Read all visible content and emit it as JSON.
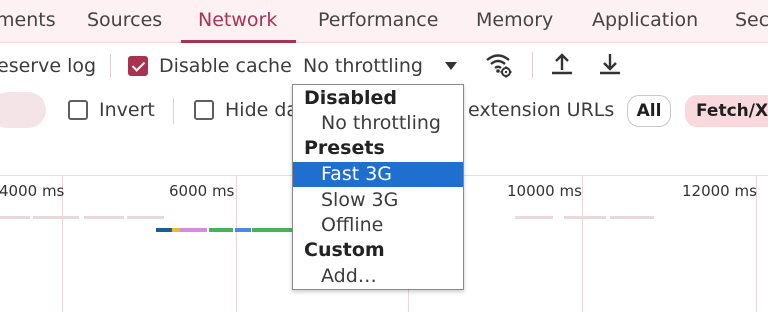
{
  "tabs": [
    {
      "label": "ments",
      "active": false
    },
    {
      "label": "Sources",
      "active": false
    },
    {
      "label": "Network",
      "active": true
    },
    {
      "label": "Performance",
      "active": false
    },
    {
      "label": "Memory",
      "active": false
    },
    {
      "label": "Application",
      "active": false
    },
    {
      "label": "Sec",
      "active": false
    }
  ],
  "toolbar": {
    "preserve_log_label": "eserve log",
    "disable_cache_label": "Disable cache",
    "disable_cache_checked": true,
    "throttling_value": "No throttling"
  },
  "filter_bar": {
    "invert_label": "Invert",
    "hide_data_label": "Hide da",
    "extension_urls_label": "extension URLs",
    "all_label": "All",
    "fetch_label": "Fetch/XHR"
  },
  "timeline": {
    "ticks": [
      "4000 ms",
      "6000 ms",
      "10000 ms",
      "12000 ms"
    ]
  },
  "throttling_menu": {
    "groups": [
      {
        "header": "Disabled",
        "options": [
          {
            "label": "No throttling",
            "selected": false
          }
        ]
      },
      {
        "header": "Presets",
        "options": [
          {
            "label": "Fast 3G",
            "selected": true
          },
          {
            "label": "Slow 3G",
            "selected": false
          },
          {
            "label": "Offline",
            "selected": false
          }
        ]
      },
      {
        "header": "Custom",
        "options": [
          {
            "label": "Add…",
            "selected": false
          }
        ]
      }
    ]
  },
  "colors": {
    "accent": "#a8324f",
    "selected_option": "#1f6fd1"
  },
  "icons": {
    "network_conditions": "wifi-gear-icon",
    "import": "upload-icon",
    "export": "download-icon"
  }
}
